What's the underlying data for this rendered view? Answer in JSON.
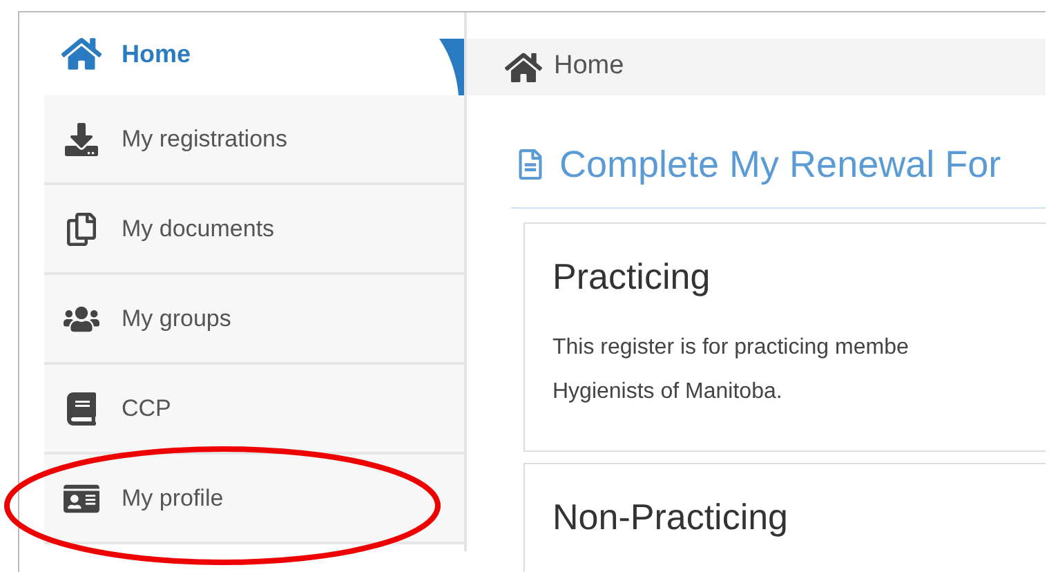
{
  "sidebar": {
    "items": [
      {
        "label": "Home",
        "selected": true,
        "circled": false
      },
      {
        "label": "My registrations",
        "selected": false,
        "circled": false
      },
      {
        "label": "My documents",
        "selected": false,
        "circled": false
      },
      {
        "label": "My groups",
        "selected": false,
        "circled": false
      },
      {
        "label": "CCP",
        "selected": false,
        "circled": false
      },
      {
        "label": "My profile",
        "selected": false,
        "circled": true
      }
    ]
  },
  "breadcrumb": {
    "label": "Home"
  },
  "page_title": "Complete My Renewal For",
  "registers": [
    {
      "title": "Practicing",
      "description": [
        "This register is for practicing membe",
        "Hygienists of Manitoba."
      ]
    },
    {
      "title": "Non-Practicing"
    }
  ]
}
